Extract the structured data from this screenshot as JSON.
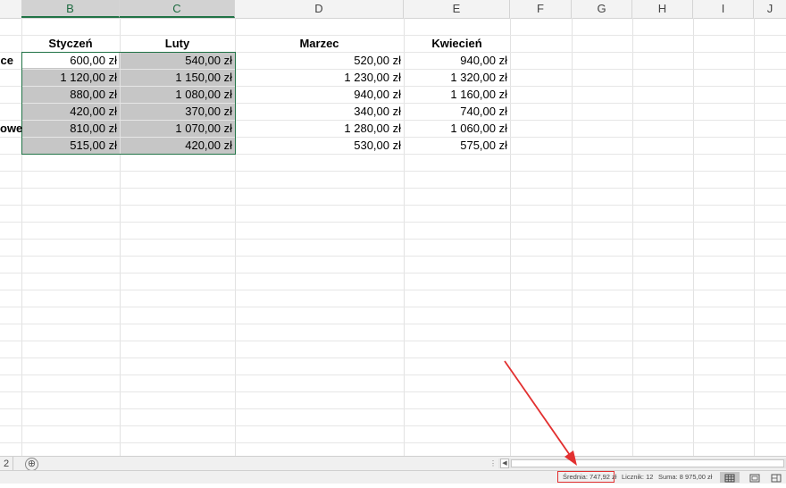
{
  "columns": [
    {
      "letter": "B",
      "selected": true
    },
    {
      "letter": "C",
      "selected": true
    },
    {
      "letter": "D",
      "selected": false
    },
    {
      "letter": "E",
      "selected": false
    },
    {
      "letter": "F",
      "selected": false
    },
    {
      "letter": "G",
      "selected": false
    },
    {
      "letter": "H",
      "selected": false
    },
    {
      "letter": "I",
      "selected": false
    },
    {
      "letter": "J",
      "selected": false
    }
  ],
  "table": {
    "headers": [
      "Styczeń",
      "Luty",
      "Marzec",
      "Kwiecień"
    ],
    "row_labels": [
      "ce",
      "",
      "",
      "",
      "owe",
      ""
    ],
    "rows": [
      [
        "600,00 zł",
        "540,00 zł",
        "520,00 zł",
        "940,00 zł"
      ],
      [
        "1 120,00 zł",
        "1 150,00 zł",
        "1 230,00 zł",
        "1 320,00 zł"
      ],
      [
        "880,00 zł",
        "1 080,00 zł",
        "940,00 zł",
        "1 160,00 zł"
      ],
      [
        "420,00 zł",
        "370,00 zł",
        "340,00 zł",
        "740,00 zł"
      ],
      [
        "810,00 zł",
        "1 070,00 zł",
        "1 280,00 zł",
        "1 060,00 zł"
      ],
      [
        "515,00 zł",
        "420,00 zł",
        "530,00 zł",
        "575,00 zł"
      ]
    ]
  },
  "tabbar": {
    "sheet_number": "2",
    "add_sheet": "⊕"
  },
  "status": {
    "average": "Średnia: 747,92 zł",
    "count": "Licznik: 12",
    "sum": "Suma: 8 975,00 zł"
  },
  "colors": {
    "accent": "#217346",
    "selection": "#c6c6c6",
    "highlight": "#e23030"
  },
  "icons": [
    "add-sheet-icon",
    "normal-view-icon",
    "page-layout-icon",
    "page-break-icon",
    "scroll-left-icon"
  ]
}
